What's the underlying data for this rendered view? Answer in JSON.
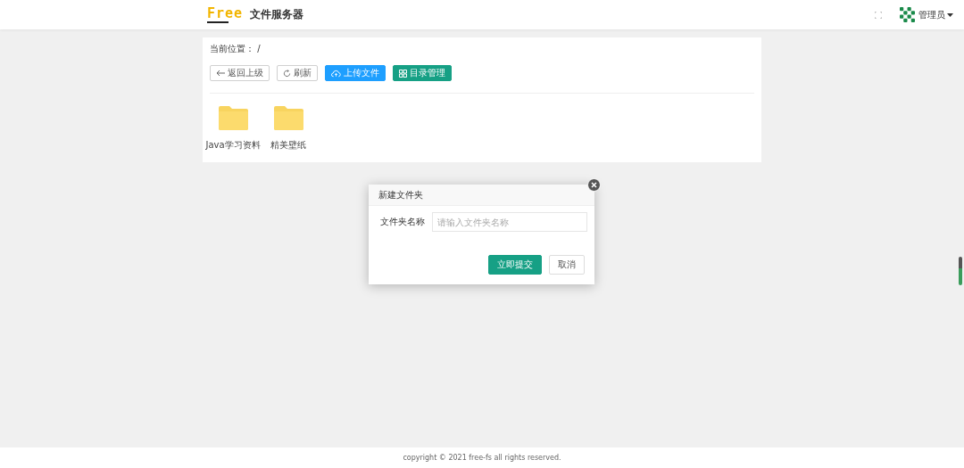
{
  "header": {
    "logo": "Free",
    "title": "文件服务器",
    "user": "管理员"
  },
  "breadcrumb": {
    "label": "当前位置：",
    "path": "/"
  },
  "toolbar": [
    {
      "kind": "back",
      "label": "返回上级"
    },
    {
      "kind": "refresh",
      "label": "刷新"
    },
    {
      "kind": "upload",
      "label": "上传文件"
    },
    {
      "kind": "manage",
      "label": "目录管理"
    }
  ],
  "folders": [
    {
      "name": "Java学习资料"
    },
    {
      "name": "精美壁纸"
    }
  ],
  "dialog": {
    "title": "新建文件夹",
    "field_label": "文件夹名称",
    "placeholder": "请输入文件夹名称",
    "buttons": [
      {
        "kind": "primary",
        "label": "立即提交"
      },
      {
        "kind": "secondary",
        "label": "取消"
      }
    ]
  },
  "footer": "copyright © 2021 free-fs all rights reserved."
}
